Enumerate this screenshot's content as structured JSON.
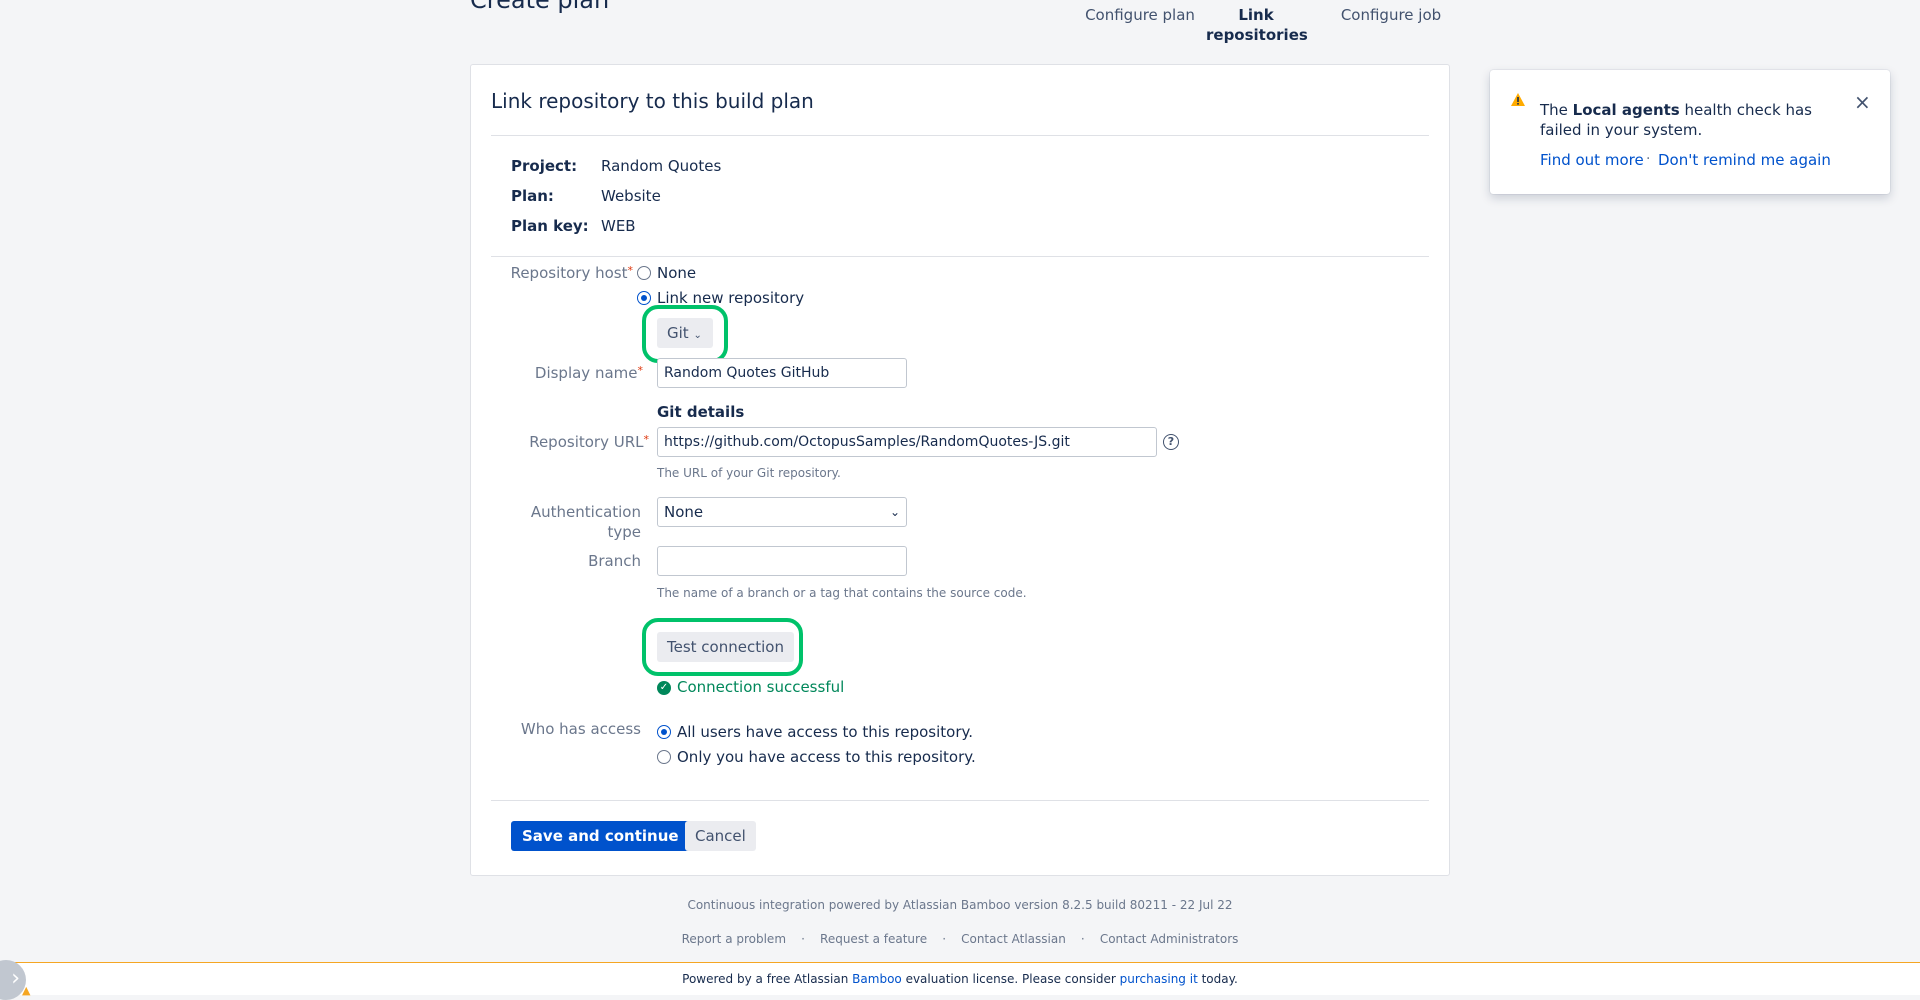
{
  "header": {
    "page_title": "Create plan",
    "steps": [
      {
        "label": "Configure plan"
      },
      {
        "label": "Link repositories"
      },
      {
        "label": "Configure job"
      }
    ]
  },
  "panel": {
    "title": "Link repository to this build plan",
    "meta": [
      {
        "label": "Project:",
        "value": "Random Quotes"
      },
      {
        "label": "Plan:",
        "value": "Website"
      },
      {
        "label": "Plan key:",
        "value": "WEB"
      }
    ],
    "repository_host": {
      "label": "Repository host",
      "options": [
        "None",
        "Link new repository"
      ],
      "selected": "Link new repository",
      "type_button": "Git"
    },
    "display_name": {
      "label": "Display name",
      "value": "Random Quotes GitHub"
    },
    "git_details": {
      "heading": "Git details",
      "url_label": "Repository URL",
      "url_value": "https://github.com/OctopusSamples/RandomQuotes-JS.git",
      "url_hint": "The URL of your Git repository.",
      "auth_label": "Authentication type",
      "auth_value": "None",
      "branch_label": "Branch",
      "branch_value": "",
      "branch_hint": "The name of a branch or a tag that contains the source code."
    },
    "test_connection": {
      "label": "Test connection",
      "status": "Connection successful"
    },
    "access": {
      "label": "Who has access",
      "options": [
        "All users have access to this repository.",
        "Only you have access to this repository."
      ],
      "selected": "All users have access to this repository."
    },
    "actions": {
      "save": "Save and continue",
      "cancel": "Cancel"
    }
  },
  "flag": {
    "text_before": "The ",
    "bold": "Local agents",
    "text_after": " health check has failed in your system.",
    "link_find": "Find out more",
    "separator": "·",
    "link_dismiss": "Don't remind me again"
  },
  "footer": {
    "powered": "Continuous integration powered by Atlassian Bamboo version 8.2.5 build 80211 - 22 Jul 22",
    "links": [
      "Report a problem",
      "Request a feature",
      "Contact Atlassian",
      "Contact Administrators"
    ],
    "dot": "·"
  },
  "license": {
    "prefix": "Powered by a free Atlassian ",
    "bamboo": "Bamboo",
    "middle": " evaluation license. Please consider ",
    "purchase": "purchasing it",
    "suffix": " today."
  },
  "colors": {
    "accent": "#0052cc",
    "success": "#00875a",
    "highlight": "#00c26a",
    "warning": "#ffab00"
  }
}
